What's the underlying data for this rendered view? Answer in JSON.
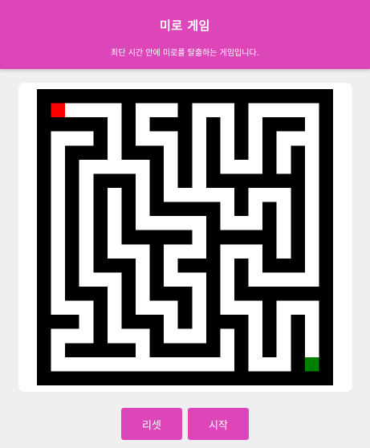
{
  "header": {
    "title": "미로 게임",
    "subtitle": "최단 시간 안에 미로를 탈출하는 게임입니다."
  },
  "colors": {
    "brand": "#dc46b9",
    "wall": "#000000",
    "path": "#ffffff",
    "player": "#ff0000",
    "goal": "#008000"
  },
  "maze": {
    "cols": 21,
    "rows": 21,
    "player": [
      1,
      1
    ],
    "goal": [
      19,
      19
    ],
    "grid": [
      "#####################",
      "#P    #   #   #     #",
      "##### # ### # # ### #",
      "#   # #   # # # #   #",
      "# ### ### # # # # # #",
      "# #     # # #   # # #",
      "# # ### # # ####### #",
      "# # # # #     #   # #",
      "# # # # ##### # # # #",
      "# # # #     #   # # #",
      "# # # ##### ##### # #",
      "# # #   #   #   # # #",
      "# # ### # ### # ### #",
      "# #   # #   # #     #",
      "# ### # ### # #######",
      "#   # #   # #   #   #",
      "### # ### # ### # # #",
      "#   #   #   # # # # #",
      "# ##### ##### # # # #",
      "#             #   #G#",
      "#####################"
    ]
  },
  "buttons": {
    "reset": "리셋",
    "start": "시작"
  }
}
